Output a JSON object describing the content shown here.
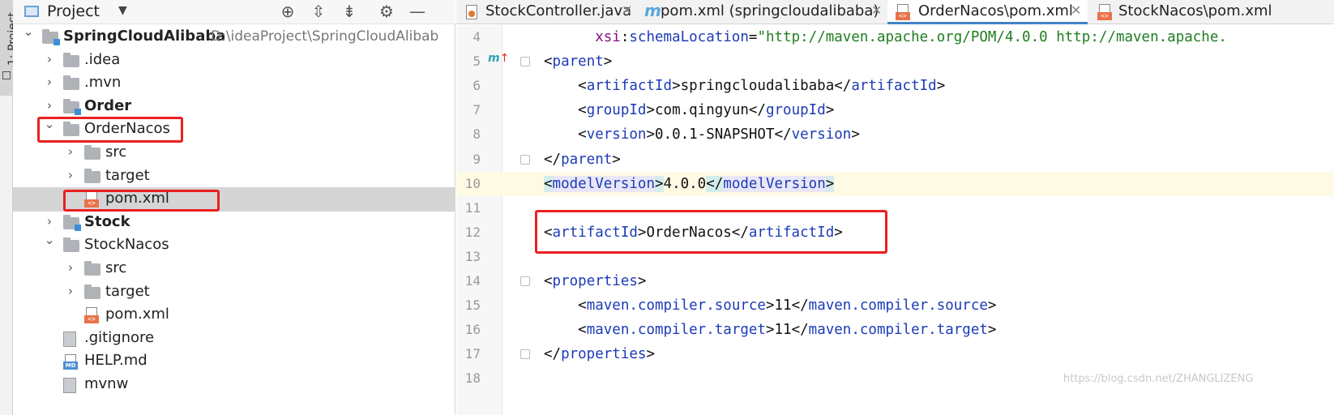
{
  "side_strip": {
    "tab_label": "1: Project"
  },
  "project_panel": {
    "title": "Project",
    "header_icons": [
      "globe-icon",
      "expand-all-icon",
      "collapse-all-icon",
      "gear-icon",
      "minimize-icon"
    ],
    "tree": [
      {
        "label": "SpringCloudAlibaba",
        "hint": "D:\\ideaProject\\SpringCloudAlibab",
        "level": 0,
        "expanded": true,
        "icon": "module-folder",
        "bold": true
      },
      {
        "label": ".idea",
        "level": 1,
        "expanded": false,
        "icon": "folder"
      },
      {
        "label": ".mvn",
        "level": 1,
        "expanded": false,
        "icon": "folder"
      },
      {
        "label": "Order",
        "level": 1,
        "expanded": false,
        "icon": "module-folder",
        "bold": true
      },
      {
        "label": "OrderNacos",
        "level": 1,
        "expanded": true,
        "icon": "folder"
      },
      {
        "label": "src",
        "level": 2,
        "expanded": false,
        "icon": "folder"
      },
      {
        "label": "target",
        "level": 2,
        "expanded": false,
        "icon": "folder"
      },
      {
        "label": "pom.xml",
        "level": 2,
        "icon": "xml",
        "selected": true
      },
      {
        "label": "Stock",
        "level": 1,
        "expanded": false,
        "icon": "module-folder",
        "bold": true
      },
      {
        "label": "StockNacos",
        "level": 1,
        "expanded": true,
        "icon": "folder"
      },
      {
        "label": "src",
        "level": 2,
        "expanded": false,
        "icon": "folder"
      },
      {
        "label": "target",
        "level": 2,
        "expanded": false,
        "icon": "folder"
      },
      {
        "label": "pom.xml",
        "level": 2,
        "icon": "xml"
      },
      {
        "label": ".gitignore",
        "level": 1,
        "icon": "file"
      },
      {
        "label": "HELP.md",
        "level": 1,
        "icon": "md"
      },
      {
        "label": "mvnw",
        "level": 1,
        "icon": "file"
      }
    ]
  },
  "editor_tabs": [
    {
      "label": "StockController.java",
      "icon": "java-file-icon",
      "active": false
    },
    {
      "label": "pom.xml (springcloudalibaba)",
      "icon": "maven-icon",
      "active": false
    },
    {
      "label": "OrderNacos\\pom.xml",
      "icon": "xml-file-icon",
      "active": true
    },
    {
      "label": "StockNacos\\pom.xml",
      "icon": "xml-file-icon",
      "active": false
    }
  ],
  "editor": {
    "lines": [
      {
        "n": "4",
        "indent": "      ",
        "segments": [
          {
            "t": "attr",
            "v": "xsi"
          },
          {
            "t": "plain",
            "v": ":"
          },
          {
            "t": "tag",
            "v": "schemaLocation"
          },
          {
            "t": "plain",
            "v": "="
          },
          {
            "t": "str",
            "v": "\"http://maven.apache.org/POM/4.0.0 http://maven.apache."
          }
        ]
      },
      {
        "n": "5",
        "indent": "",
        "segments": [
          {
            "t": "plain",
            "v": "<"
          },
          {
            "t": "tag",
            "v": "parent"
          },
          {
            "t": "plain",
            "v": ">"
          }
        ]
      },
      {
        "n": "6",
        "indent": "    ",
        "segments": [
          {
            "t": "plain",
            "v": "<"
          },
          {
            "t": "tag",
            "v": "artifactId"
          },
          {
            "t": "plain",
            "v": ">springcloudalibaba</"
          },
          {
            "t": "tag",
            "v": "artifactId"
          },
          {
            "t": "plain",
            "v": ">"
          }
        ]
      },
      {
        "n": "7",
        "indent": "    ",
        "segments": [
          {
            "t": "plain",
            "v": "<"
          },
          {
            "t": "tag",
            "v": "groupId"
          },
          {
            "t": "plain",
            "v": ">com.qingyun</"
          },
          {
            "t": "tag",
            "v": "groupId"
          },
          {
            "t": "plain",
            "v": ">"
          }
        ]
      },
      {
        "n": "8",
        "indent": "    ",
        "segments": [
          {
            "t": "plain",
            "v": "<"
          },
          {
            "t": "tag",
            "v": "version"
          },
          {
            "t": "plain",
            "v": ">0.0.1-SNAPSHOT</"
          },
          {
            "t": "tag",
            "v": "version"
          },
          {
            "t": "plain",
            "v": ">"
          }
        ]
      },
      {
        "n": "9",
        "indent": "",
        "segments": [
          {
            "t": "plain",
            "v": "</"
          },
          {
            "t": "tag",
            "v": "parent"
          },
          {
            "t": "plain",
            "v": ">"
          }
        ]
      },
      {
        "n": "10",
        "indent": "",
        "highlight": true,
        "segments": [
          {
            "t": "hl",
            "v": "<"
          },
          {
            "t": "tag-hl2",
            "v": "modelVersion"
          },
          {
            "t": "hl",
            "v": ">"
          },
          {
            "t": "plain",
            "v": "4.0.0"
          },
          {
            "t": "hl",
            "v": "</"
          },
          {
            "t": "tag-hl2",
            "v": "modelVersion"
          },
          {
            "t": "hl",
            "v": ">"
          }
        ]
      },
      {
        "n": "11",
        "indent": "",
        "segments": []
      },
      {
        "n": "12",
        "indent": "",
        "segments": [
          {
            "t": "plain",
            "v": "<"
          },
          {
            "t": "tag",
            "v": "artifactId"
          },
          {
            "t": "plain",
            "v": ">OrderNacos</"
          },
          {
            "t": "tag",
            "v": "artifactId"
          },
          {
            "t": "plain",
            "v": ">"
          }
        ]
      },
      {
        "n": "13",
        "indent": "",
        "segments": []
      },
      {
        "n": "14",
        "indent": "",
        "segments": [
          {
            "t": "plain",
            "v": "<"
          },
          {
            "t": "tag",
            "v": "properties"
          },
          {
            "t": "plain",
            "v": ">"
          }
        ]
      },
      {
        "n": "15",
        "indent": "    ",
        "segments": [
          {
            "t": "plain",
            "v": "<"
          },
          {
            "t": "tag",
            "v": "maven.compiler.source"
          },
          {
            "t": "plain",
            "v": ">11</"
          },
          {
            "t": "tag",
            "v": "maven.compiler.source"
          },
          {
            "t": "plain",
            "v": ">"
          }
        ]
      },
      {
        "n": "16",
        "indent": "    ",
        "segments": [
          {
            "t": "plain",
            "v": "<"
          },
          {
            "t": "tag",
            "v": "maven.compiler.target"
          },
          {
            "t": "plain",
            "v": ">11</"
          },
          {
            "t": "tag",
            "v": "maven.compiler.target"
          },
          {
            "t": "plain",
            "v": ">"
          }
        ]
      },
      {
        "n": "17",
        "indent": "",
        "segments": [
          {
            "t": "plain",
            "v": "</"
          },
          {
            "t": "tag",
            "v": "properties"
          },
          {
            "t": "plain",
            "v": ">"
          }
        ]
      },
      {
        "n": "18",
        "indent": "",
        "segments": []
      }
    ],
    "gutter_marker": {
      "letter": "m",
      "arrow": "↑"
    }
  },
  "watermark": "https://blog.csdn.net/ZHANGLIZENG",
  "colors": {
    "highlight_box": "#ea1f1f",
    "selected_row": "#d5d5d5",
    "current_line": "#fffae3",
    "xml_tag": "#1c3bb8"
  }
}
